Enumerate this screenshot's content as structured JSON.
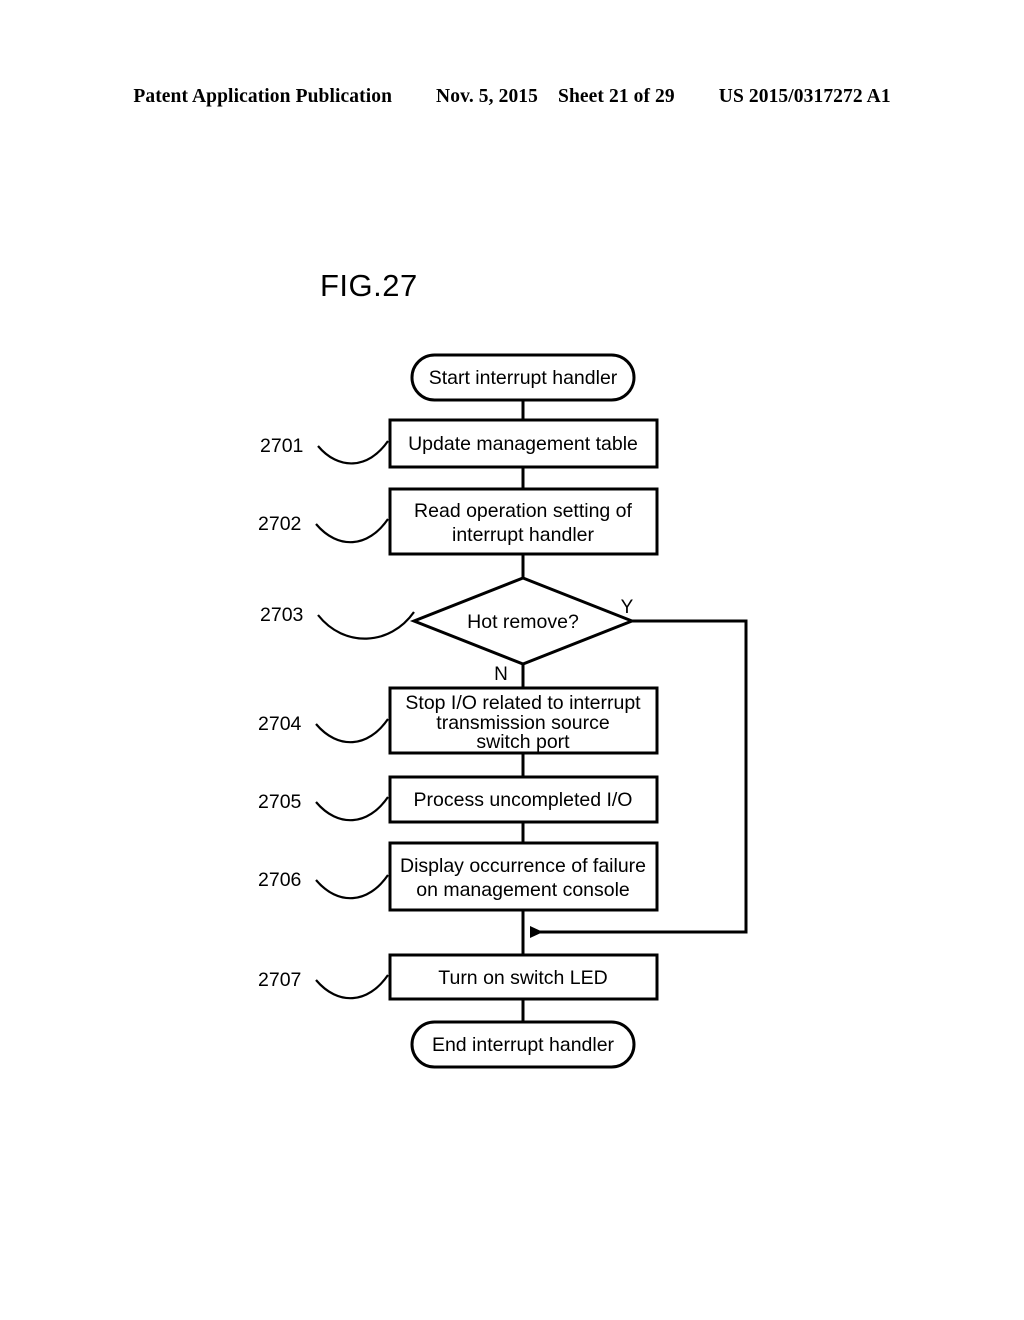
{
  "header": {
    "publication": "Patent Application Publication",
    "date": "Nov. 5, 2015",
    "sheet": "Sheet 21 of 29",
    "patent_number": "US 2015/0317272 A1"
  },
  "figure": {
    "title": "FIG.27"
  },
  "flowchart": {
    "type": "flowchart",
    "start": {
      "label": "Start interrupt handler",
      "shape": "terminator"
    },
    "end": {
      "label": "End interrupt handler",
      "shape": "terminator"
    },
    "steps": [
      {
        "ref": "2701",
        "shape": "process",
        "lines": [
          "Update management table"
        ]
      },
      {
        "ref": "2702",
        "shape": "process",
        "lines": [
          "Read operation setting of",
          "interrupt handler"
        ]
      },
      {
        "ref": "2703",
        "shape": "decision",
        "lines": [
          "Hot remove?"
        ],
        "branch_yes": "Y",
        "branch_no": "N"
      },
      {
        "ref": "2704",
        "shape": "process",
        "lines": [
          "Stop I/O related to interrupt",
          "transmission source",
          "switch port"
        ]
      },
      {
        "ref": "2705",
        "shape": "process",
        "lines": [
          "Process uncompleted I/O"
        ]
      },
      {
        "ref": "2706",
        "shape": "process",
        "lines": [
          "Display occurrence of failure",
          "on management console"
        ]
      },
      {
        "ref": "2707",
        "shape": "process",
        "lines": [
          "Turn on switch LED"
        ]
      }
    ]
  },
  "colors": {
    "ink": "#000000",
    "paper": "#ffffff"
  }
}
